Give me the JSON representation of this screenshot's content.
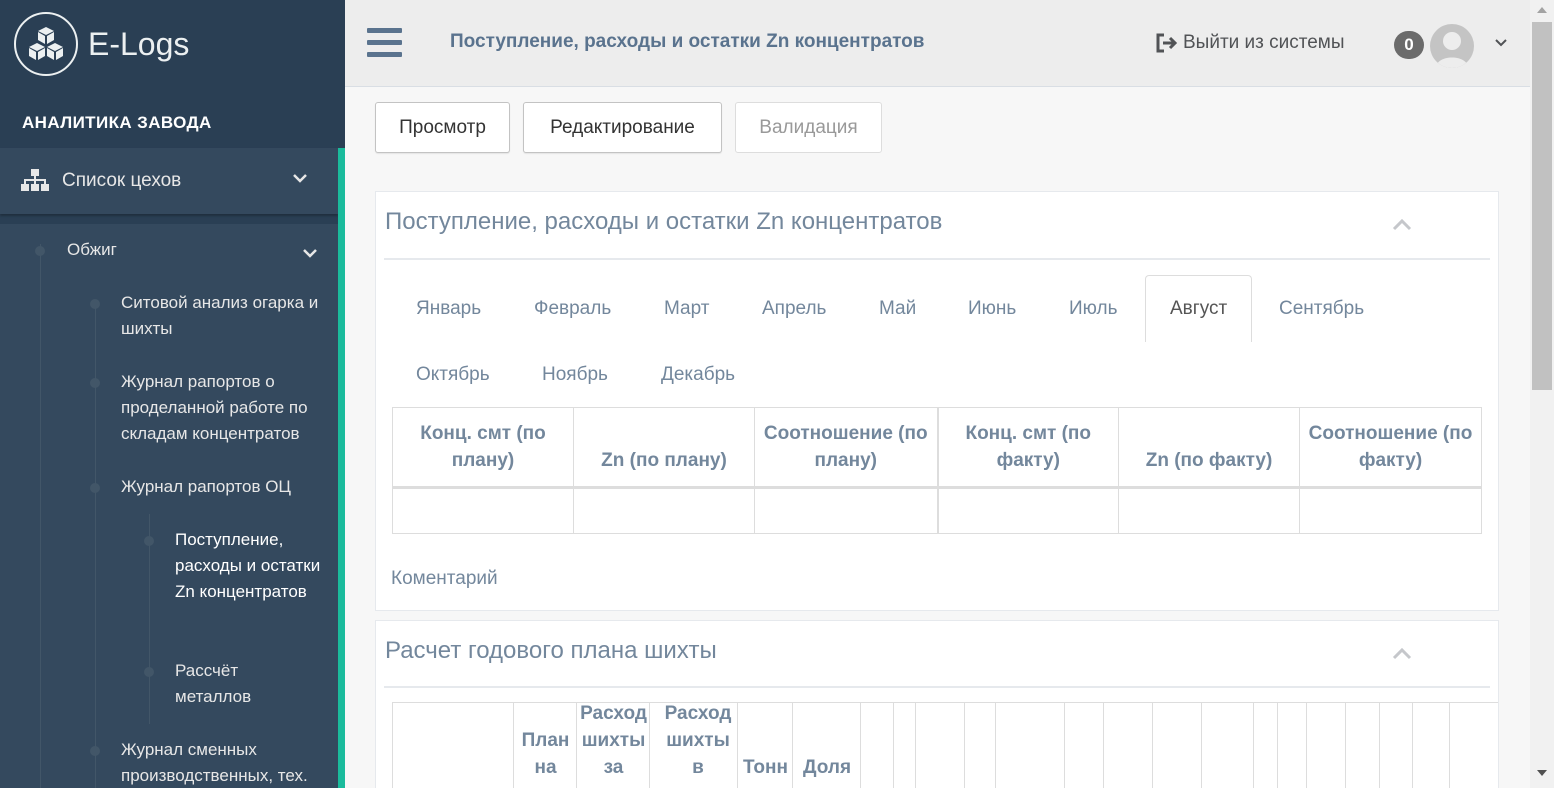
{
  "brand": {
    "name": "E-Logs",
    "logo_icon": "cubes-icon"
  },
  "sidebar": {
    "section_title": "АНАЛИТИКА ЗАВОДА",
    "menu_top": {
      "label": "Список цехов",
      "icon": "sitemap-icon"
    },
    "group": "Обжиг",
    "items": [
      "Ситовой анализ огарка и шихты",
      "Журнал рапортов о проделанной работе по складам концентратов",
      "Журнал рапортов ОЦ",
      "Журнал сменных производственных, тех."
    ],
    "subitems": [
      "Поступление, расходы и остатки Zn концентратов",
      "Рассчёт металлов"
    ],
    "accent_color": "#1abb9c"
  },
  "topbar": {
    "title": "Поступление, расходы и остатки Zn концентратов",
    "logout": "Выйти из системы",
    "notifications": "0"
  },
  "modes": [
    "Просмотр",
    "Редактирование",
    "Валидация"
  ],
  "panel1": {
    "title": "Поступление, расходы и остатки Zn концентратов",
    "months": [
      "Январь",
      "Февраль",
      "Март",
      "Апрель",
      "Май",
      "Июнь",
      "Июль",
      "Август",
      "Сентябрь",
      "Октябрь",
      "Ноябрь",
      "Декабрь"
    ],
    "active_month": "Август",
    "columns": [
      "Конц. смт (по плану)",
      "Zn (по плану)",
      "Соотношение (по плану)",
      "Конц. смт (по факту)",
      "Zn (по факту)",
      "Соотношение (по факту)"
    ],
    "comment_label": "Коментарий"
  },
  "panel2": {
    "title": "Расчет годового плана шихты",
    "columns": [
      "План на",
      "Расход шихты за",
      "Расход шихты в",
      "Тонн",
      "Доля"
    ]
  }
}
